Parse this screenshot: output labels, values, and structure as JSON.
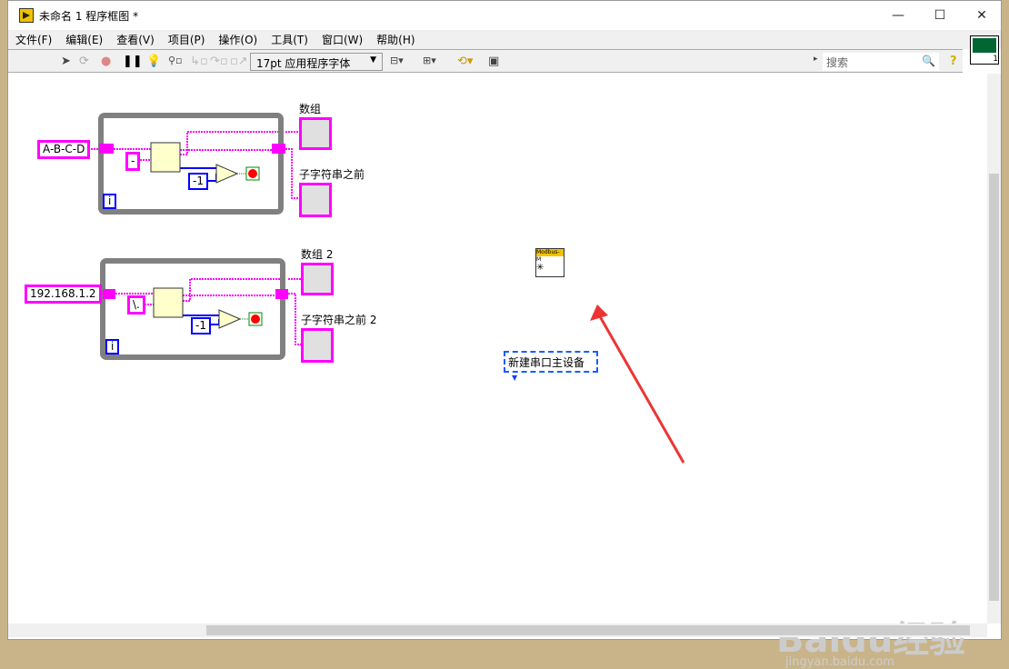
{
  "window": {
    "title": "未命名 1 程序框图 *",
    "minimize": "—",
    "maximize": "☐",
    "close": "✕"
  },
  "menu": [
    "文件(F)",
    "编辑(E)",
    "查看(V)",
    "项目(P)",
    "操作(O)",
    "工具(T)",
    "窗口(W)",
    "帮助(H)"
  ],
  "toolbar": {
    "font": "17pt 应用程序字体",
    "search_placeholder": "搜索",
    "help": "?"
  },
  "connector_pane": {
    "number": "1"
  },
  "diagram": {
    "loop1": {
      "input": "A-B-C-D",
      "delimiter": "-",
      "constant": "-1",
      "iteration": "i",
      "array_label": "数组",
      "string_label": "子字符串之前"
    },
    "loop2": {
      "input": "192.168.1.2",
      "delimiter": "\\.",
      "constant": "-1",
      "iteration": "i",
      "array_label": "数组 2",
      "string_label": "子字符串之前 2"
    },
    "modbus": {
      "header": "Modbus-M",
      "ring": "新建串口主设备"
    }
  },
  "watermark": {
    "brand": "Baidu经验",
    "url": "jingyan.baidu.com"
  },
  "colors": {
    "string_wire": "#ff00ff",
    "numeric_wire": "#0000ff",
    "loop_frame": "#808080",
    "arrow": "#ee3333"
  }
}
